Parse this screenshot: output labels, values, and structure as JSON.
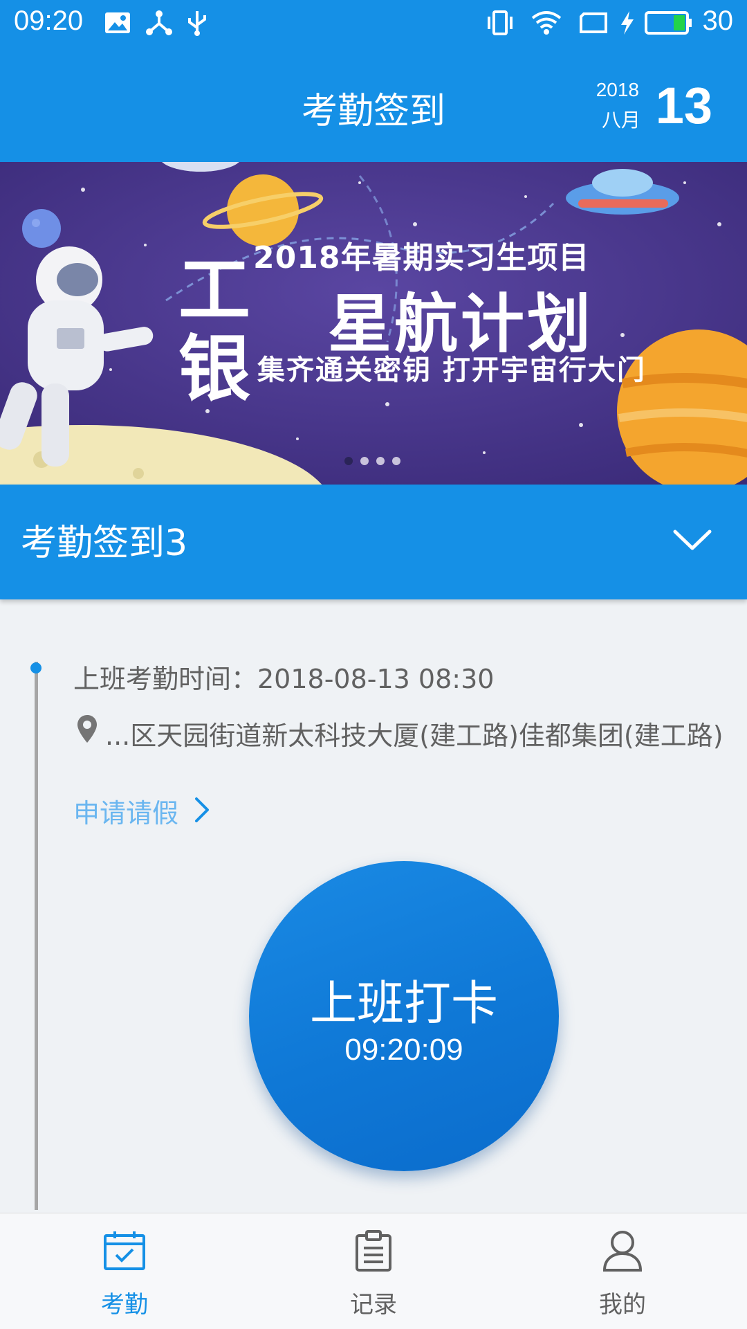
{
  "status_bar": {
    "time": "09:20",
    "battery_level": "30",
    "icons": [
      "image-icon",
      "share-node-icon",
      "usb-icon",
      "vibrate-icon",
      "wifi-icon",
      "screen-icon",
      "charging-icon",
      "battery-icon"
    ]
  },
  "header": {
    "title": "考勤签到",
    "date_year": "2018",
    "date_month": "八月",
    "date_day": "13"
  },
  "banner": {
    "subtitle": "2018年暑期实习生项目",
    "brand_char_1": "工",
    "brand_char_2": "银",
    "main_title": "星航计划",
    "slogan": "集齐通关密钥 打开宇宙行大门",
    "page_indicator": {
      "total": 4,
      "active": 1
    }
  },
  "group_selector": {
    "label": "考勤签到3",
    "icon": "chevron-down-icon"
  },
  "attendance": {
    "work_time": "上班考勤时间：2018-08-13 08:30",
    "location": "...区天园街道新太科技大厦(建工路)佳都集团(建工路)",
    "leave_link": "申请请假"
  },
  "punch_button": {
    "label": "上班打卡",
    "clock": "09:20:09"
  },
  "bottom_nav": {
    "items": [
      {
        "label": "考勤",
        "icon": "calendar-check-icon",
        "active": true
      },
      {
        "label": "记录",
        "icon": "clipboard-icon",
        "active": false
      },
      {
        "label": "我的",
        "icon": "user-icon",
        "active": false
      }
    ]
  },
  "colors": {
    "primary": "#1590e6",
    "link": "#6ab6f0",
    "text_secondary": "#616161",
    "background": "#eff2f5"
  }
}
